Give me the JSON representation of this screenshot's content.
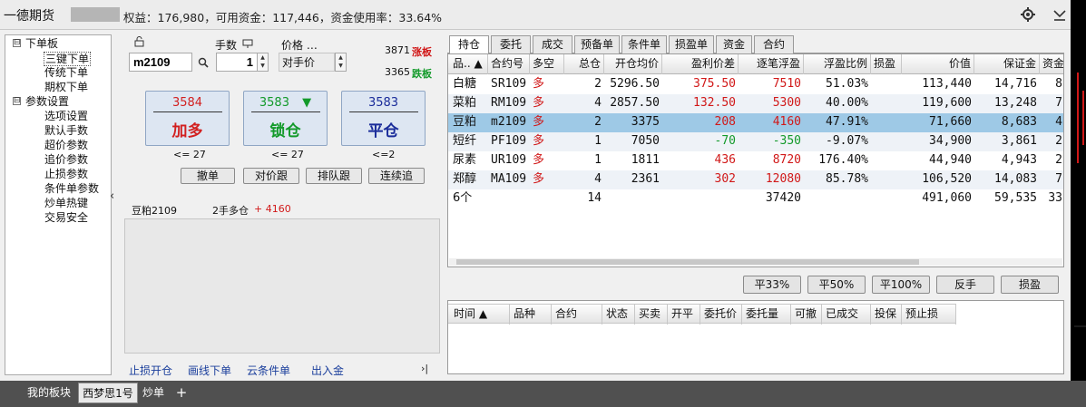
{
  "titlebar": {
    "brand": "一德期货",
    "stats": "权益：176,980，可用资金：117,446，资金使用率：33.64%"
  },
  "tree": {
    "nodes": [
      {
        "label": "下单板",
        "expander": "⊟"
      },
      {
        "label": "三键下单"
      },
      {
        "label": "传统下单"
      },
      {
        "label": "期权下单"
      },
      {
        "label": "参数设置",
        "expander": "⊟"
      },
      {
        "label": "选项设置"
      },
      {
        "label": "默认手数"
      },
      {
        "label": "超价参数"
      },
      {
        "label": "追价参数"
      },
      {
        "label": "止损参数"
      },
      {
        "label": "条件单参数"
      },
      {
        "label": "炒单热键"
      },
      {
        "label": "交易安全"
      }
    ],
    "splitter_glyph": "‹"
  },
  "order": {
    "contract": "m2109",
    "qty_label": "手数",
    "qty": "1",
    "price_label": "价格 …",
    "price_value": "对手价",
    "limit_up_price": "3871",
    "limit_up_label": "涨板",
    "limit_down_price": "3365",
    "limit_down_label": "跌板",
    "buttons": [
      {
        "price": "3584",
        "action": "加多",
        "limit": "<= 27",
        "color": "#d22020"
      },
      {
        "price": "3583",
        "arrow": "▼",
        "action": "锁仓",
        "limit": "<= 27",
        "color": "#139a2a"
      },
      {
        "price": "3583",
        "action": "平仓",
        "limit": "<=2",
        "color": "#1a2c9a"
      }
    ],
    "small_buttons": [
      "撤单",
      "对价跟",
      "排队跟",
      "连续追"
    ],
    "position_name": "豆粕2109",
    "position_desc": "2手多仓",
    "position_pnl": "+ 4160",
    "bottom_links": [
      "止损开仓",
      "画线下单",
      "云条件单",
      "出入金"
    ],
    "expand_glyph": "›|"
  },
  "tabs": [
    "持仓",
    "委托",
    "成交",
    "预备单",
    "条件单",
    "损盈单",
    "资金",
    "合约"
  ],
  "positions": {
    "headers": [
      "品.. ▲",
      "合约号",
      "多空",
      "总仓",
      "开仓均价",
      "盈利价差",
      "逐笔浮盈",
      "浮盈比例",
      "损盈",
      "价值",
      "保证金",
      "资金"
    ],
    "rows": [
      [
        "白糖",
        "SR109",
        "多",
        "2",
        "5296.50",
        "375.50",
        "7510",
        "51.03%",
        "",
        "113,440",
        "14,716",
        "8"
      ],
      [
        "菜粕",
        "RM109",
        "多",
        "4",
        "2857.50",
        "132.50",
        "5300",
        "40.00%",
        "",
        "119,600",
        "13,248",
        "7"
      ],
      [
        "豆粕",
        "m2109",
        "多",
        "2",
        "3375",
        "208",
        "4160",
        "47.91%",
        "",
        "71,660",
        "8,683",
        "4"
      ],
      [
        "短纤",
        "PF109",
        "多",
        "1",
        "7050",
        "-70",
        "-350",
        "-9.07%",
        "",
        "34,900",
        "3,861",
        "2"
      ],
      [
        "尿素",
        "UR109",
        "多",
        "1",
        "1811",
        "436",
        "8720",
        "176.40%",
        "",
        "44,940",
        "4,943",
        "2"
      ],
      [
        "郑醇",
        "MA109",
        "多",
        "4",
        "2361",
        "302",
        "12080",
        "85.78%",
        "",
        "106,520",
        "14,083",
        "7"
      ]
    ],
    "total": [
      "6个",
      "",
      "",
      "14",
      "",
      "",
      "37420",
      "",
      "",
      "491,060",
      "59,535",
      "33"
    ],
    "row_colors": [
      "red",
      "red",
      "red",
      "green",
      "red",
      "red"
    ],
    "selected_row": 2
  },
  "close_buttons": [
    "平33%",
    "平50%",
    "平100%",
    "反手",
    "损盈"
  ],
  "orders": {
    "headers": [
      "时间 ▲",
      "品种",
      "合约",
      "状态",
      "买卖",
      "开平",
      "委托价",
      "委托量",
      "可撤",
      "已成交",
      "投保",
      "预止损"
    ]
  },
  "statusbar": {
    "tabs": [
      "我的板块",
      "西梦思1号",
      "炒单",
      "+"
    ],
    "active": 1
  },
  "colors": {
    "red": "#d11818",
    "green": "#139a2a",
    "selected_row": "#9ec9e6",
    "alt_row": "#eef2f7"
  }
}
